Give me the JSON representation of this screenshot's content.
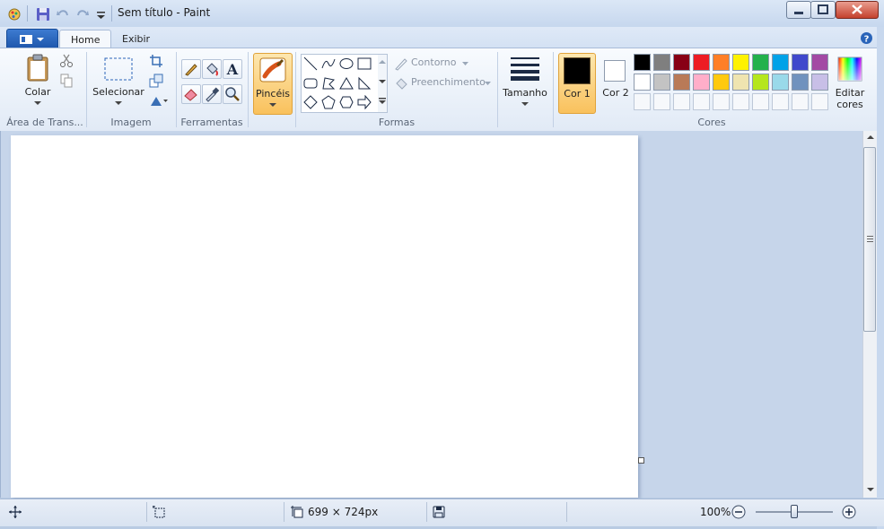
{
  "window": {
    "title": "Sem título - Paint",
    "controls": {
      "minimize": "minimize",
      "maximize": "maximize",
      "close": "close"
    }
  },
  "quick_access": [
    "paint-app-icon",
    "save-icon",
    "undo-icon",
    "redo-icon",
    "customize-dropdown-icon"
  ],
  "tabs": [
    {
      "label": "Home",
      "selected": true
    },
    {
      "label": "Exibir",
      "selected": false
    }
  ],
  "ribbon": {
    "clipboard": {
      "paste_label": "Colar",
      "group_label": "Área de Trans..."
    },
    "image": {
      "select_label": "Selecionar",
      "group_label": "Imagem"
    },
    "tools": {
      "group_label": "Ferramentas"
    },
    "brushes": {
      "label": "Pincéis"
    },
    "shapes": {
      "outline_label": "Contorno",
      "fill_label": "Preenchimento",
      "group_label": "Formas"
    },
    "size": {
      "label": "Tamanho"
    },
    "colors": {
      "color1_label": "Cor 1",
      "color2_label": "Cor 2",
      "group_label": "Cores",
      "edit_label": "Editar cores",
      "color1": "#000000",
      "color2": "#ffffff",
      "palette_row1": [
        "#000000",
        "#7f7f7f",
        "#880015",
        "#ed1c24",
        "#ff7f27",
        "#fff200",
        "#22b14c",
        "#00a2e8",
        "#3f48cc",
        "#a349a4"
      ],
      "palette_row2": [
        "#ffffff",
        "#c3c3c3",
        "#b97a57",
        "#ffaec9",
        "#ffc90e",
        "#efe4b0",
        "#b5e61d",
        "#99d9ea",
        "#7092be",
        "#c8bfe7"
      ]
    }
  },
  "status_bar": {
    "canvas_size": "699 × 724px",
    "zoom": "100%",
    "zoom_level": 1.0
  }
}
